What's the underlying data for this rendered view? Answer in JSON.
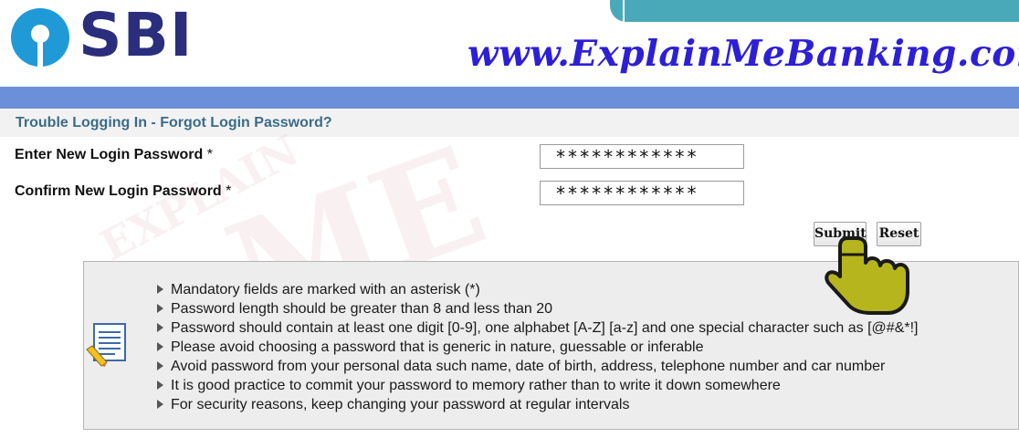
{
  "header": {
    "brand": "SBI",
    "site_url": "www.ExplainMeBanking.com"
  },
  "page": {
    "title": "Trouble Logging In - Forgot Login Password?"
  },
  "form": {
    "new_password_label": "Enter New Login Password",
    "confirm_password_label": "Confirm New Login Password",
    "required_marker": "*",
    "new_password_value": "************",
    "confirm_password_value": "************",
    "submit_label": "Submit",
    "reset_label": "Reset"
  },
  "watermark": {
    "line1": "EXPLAIN",
    "line2": "ME"
  },
  "instructions": {
    "icon": "notepad-pencil-icon",
    "items": [
      "Mandatory fields are marked with an asterisk (*)",
      "Password length should be greater than 8 and less than 20",
      "Password should contain at least one digit [0-9], one alphabet [A-Z] [a-z] and one special character such as [@#&*!]",
      "Please avoid choosing a password that is generic in nature, guessable or inferable",
      "Avoid password from your personal data such name, date of birth, address, telephone number and car number",
      "It is good practice to commit your password to memory rather than to write it down somewhere",
      "For security reasons, keep changing your password at regular intervals"
    ]
  },
  "colors": {
    "brand_blue": "#2a2e7c",
    "logo_blue": "#1f9ad6",
    "nav_bar": "#6b8fd8",
    "teal_tab": "#4aa9b9",
    "url_text": "#2c1fd6",
    "title_text": "#3b6b88"
  }
}
